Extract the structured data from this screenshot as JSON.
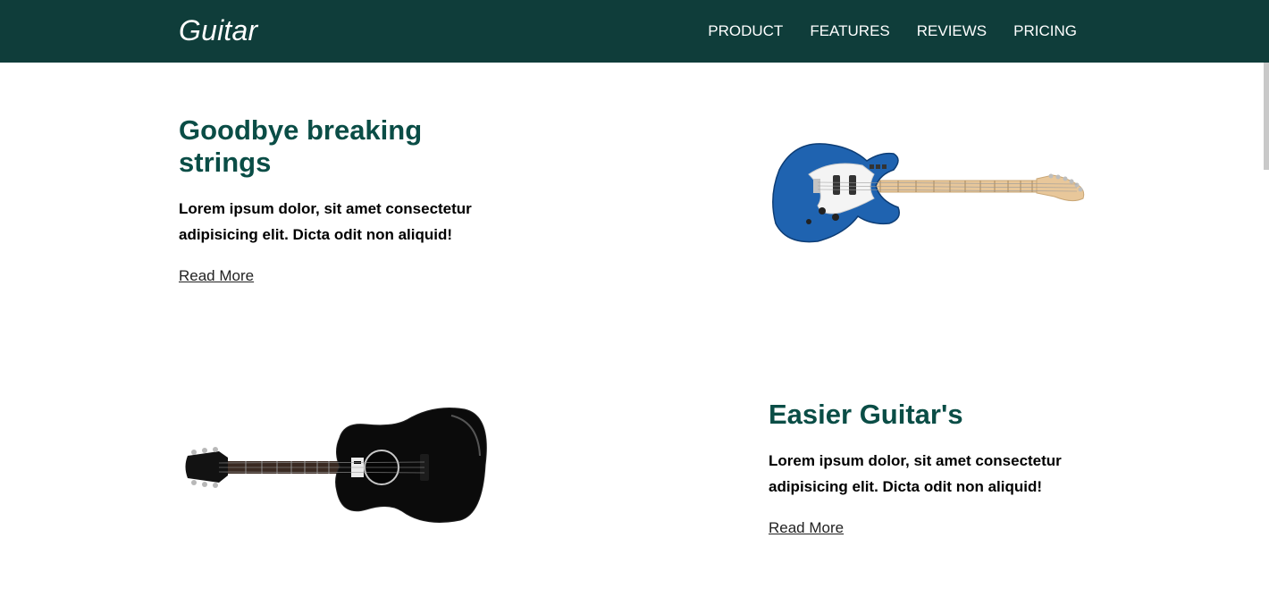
{
  "header": {
    "brand": "Guitar",
    "nav": [
      "PRODUCT",
      "FEATURES",
      "REVIEWS",
      "PRICING"
    ]
  },
  "features": [
    {
      "title": "Goodbye breaking strings",
      "text": "Lorem ipsum dolor, sit amet consectetur adipisicing elit. Dicta odit non aliquid!",
      "link": "Read More",
      "image": "electric-guitar"
    },
    {
      "title": "Easier Guitar's",
      "text": "Lorem ipsum dolor, sit amet consectetur adipisicing elit. Dicta odit non aliquid!",
      "link": "Read More",
      "image": "acoustic-guitar"
    }
  ],
  "colors": {
    "navbar": "#0f3d3a",
    "heading": "#0a4d46",
    "electric_body": "#1f63b0",
    "acoustic_body": "#0b0b0b",
    "neck_wood": "#e8c79a"
  }
}
